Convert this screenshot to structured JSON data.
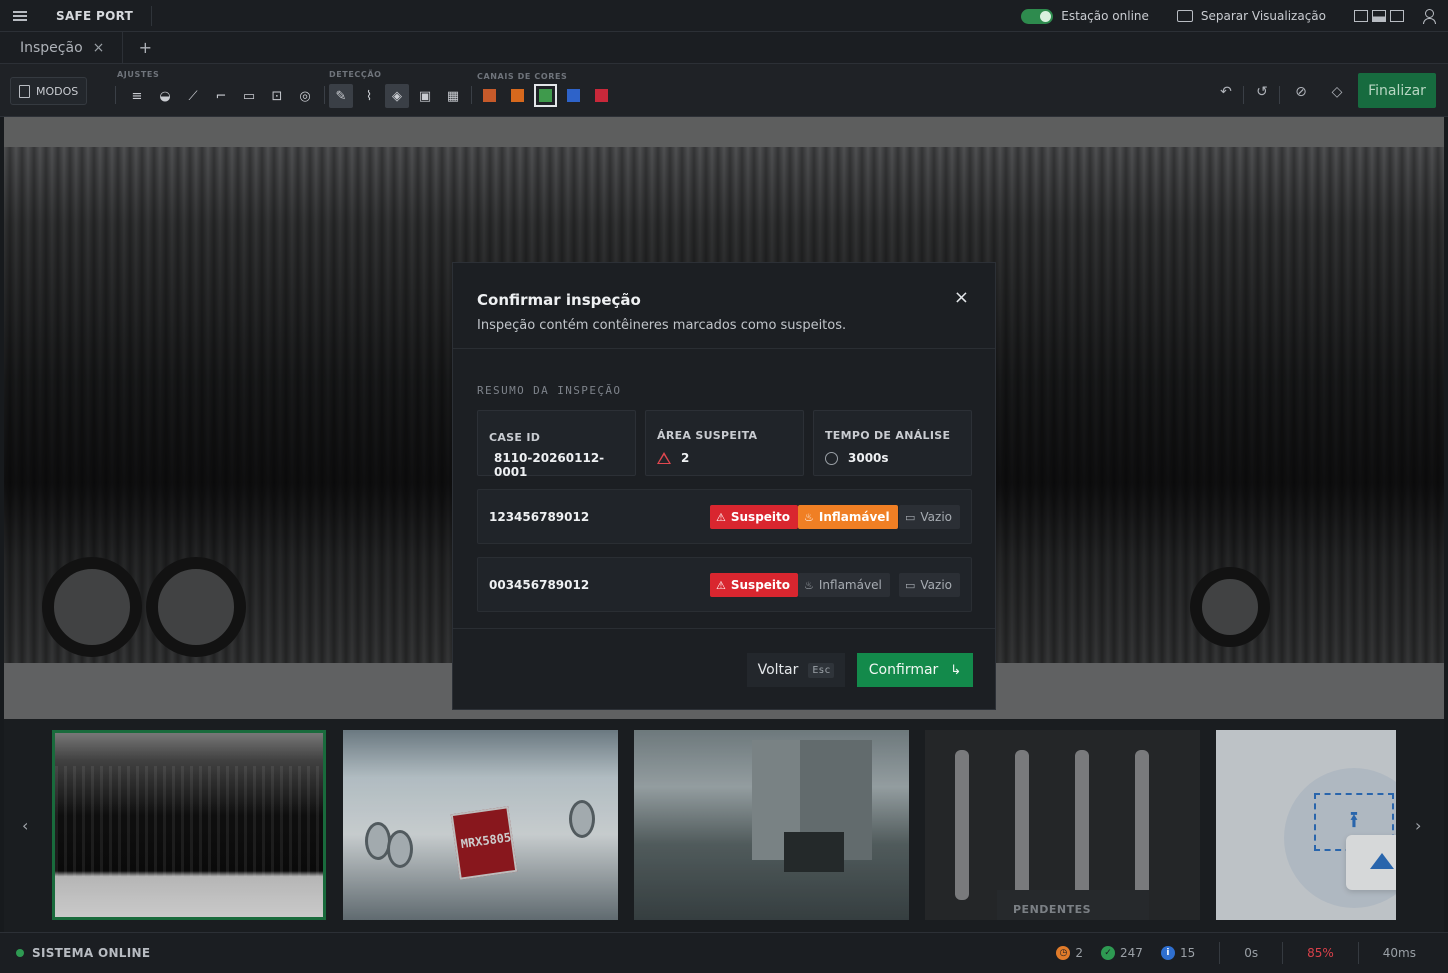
{
  "app": {
    "brand": "SAFE PORT",
    "status_label": "Estação online",
    "split_view_label": "Separar Visualização"
  },
  "tabs": [
    {
      "label": "Inspeção",
      "close": "×"
    }
  ],
  "tab_add": "+",
  "toolbar": {
    "modos_label": "MODOS",
    "groups": {
      "ajustes": "AJUSTES",
      "deteccao": "DETECÇÃO",
      "canais": "CANAIS DE CORES"
    },
    "finalizar_label": "Finalizar",
    "color_channels": [
      "#c65a2a",
      "#d7691d",
      "#3f9a4c",
      "#2e63c9",
      "#c8283a"
    ]
  },
  "thumbnails": {
    "pending_label": "PENDENTES",
    "prev": "‹",
    "next": "›"
  },
  "status_bar": {
    "system_label": "SISTEMA ONLINE",
    "pending_count": "2",
    "ok_count": "247",
    "info_count": "15",
    "time": "0s",
    "percent": "85%",
    "latency": "40ms"
  },
  "modal": {
    "title": "Confirmar inspeção",
    "description": "Inspeção contém contêineres marcados como suspeitos.",
    "close": "×",
    "section_label": "RESUMO DA INSPEÇÃO",
    "cards": {
      "case_id_label": "CASE ID",
      "case_id_value": "8110-20260112-0001",
      "area_label": "ÁREA SUSPEITA",
      "area_value": "2",
      "tempo_label": "TEMPO DE ANÁLISE",
      "tempo_value": "3000s"
    },
    "containers": [
      {
        "id": "123456789012",
        "suspeito": "Suspeito",
        "inflamavel": "Inflamável",
        "vazio": "Vazio",
        "suspeito_on": true,
        "inflamavel_on": true,
        "vazio_on": false
      },
      {
        "id": "003456789012",
        "suspeito": "Suspeito",
        "inflamavel": "Inflamável",
        "vazio": "Vazio",
        "suspeito_on": true,
        "inflamavel_on": false,
        "vazio_on": false
      }
    ],
    "back_label": "Voltar",
    "back_key": "Esc",
    "confirm_label": "Confirmar",
    "confirm_icon": "↳"
  }
}
